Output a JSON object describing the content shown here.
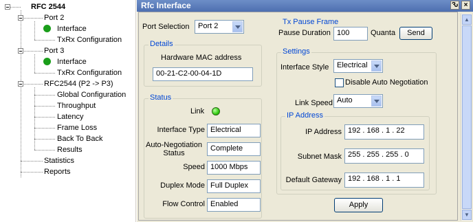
{
  "tree": {
    "root": "RFC 2544",
    "port2": {
      "label": "Port 2",
      "children": [
        "Interface",
        "TxRx Configuration"
      ]
    },
    "port3": {
      "label": "Port 3",
      "children": [
        "Interface",
        "TxRx Configuration"
      ]
    },
    "rfc": {
      "label": "RFC2544 (P2 -> P3)",
      "children": [
        "Global Configuration",
        "Throughput",
        "Latency",
        "Frame Loss",
        "Back To Back",
        "Results"
      ]
    },
    "statistics": "Statistics",
    "reports": "Reports"
  },
  "panel": {
    "title": "Rfc Interface",
    "pin_glyph": "Ԅ",
    "close_glyph": "×",
    "port_selection": {
      "label": "Port Selection",
      "value": "Port 2"
    },
    "details": {
      "title": "Details",
      "mac_label": "Hardware MAC address",
      "mac_value": "00-21-C2-00-04-1D"
    },
    "status": {
      "title": "Status",
      "link_label": "Link",
      "link_color": "#33cc11",
      "interface_type_label": "Interface Type",
      "interface_type_value": "Electrical",
      "autoneg_label_1": "Auto-Negotiation",
      "autoneg_label_2": "Status",
      "autoneg_value": "Complete",
      "speed_label": "Speed",
      "speed_value": "1000 Mbps",
      "duplex_label": "Duplex Mode",
      "duplex_value": "Full Duplex",
      "flow_label": "Flow Control",
      "flow_value": "Enabled"
    },
    "tx_pause": {
      "title": "Tx Pause Frame",
      "duration_label": "Pause Duration",
      "duration_value": "100",
      "unit": "Quanta",
      "send_label": "Send"
    },
    "settings": {
      "title": "Settings",
      "style_label": "Interface Style",
      "style_value": "Electrical",
      "disable_autoneg_label": "Disable Auto Negotiation",
      "disable_autoneg_checked": false,
      "link_speed_label": "Link Speed",
      "link_speed_value": "Auto",
      "ip": {
        "title": "IP Address",
        "ip_label": "IP Address",
        "ip_value": [
          "192",
          "168",
          "1",
          "22"
        ],
        "mask_label": "Subnet Mask",
        "mask_value": [
          "255",
          "255",
          "255",
          "0"
        ],
        "gw_label": "Default Gateway",
        "gw_value": [
          "192",
          "168",
          "1",
          "1"
        ]
      },
      "apply_label": "Apply"
    }
  },
  "colors": {
    "accent": "#0046d5",
    "title_bar": "#4e6fb0",
    "led_green": "#1a9e1a"
  }
}
